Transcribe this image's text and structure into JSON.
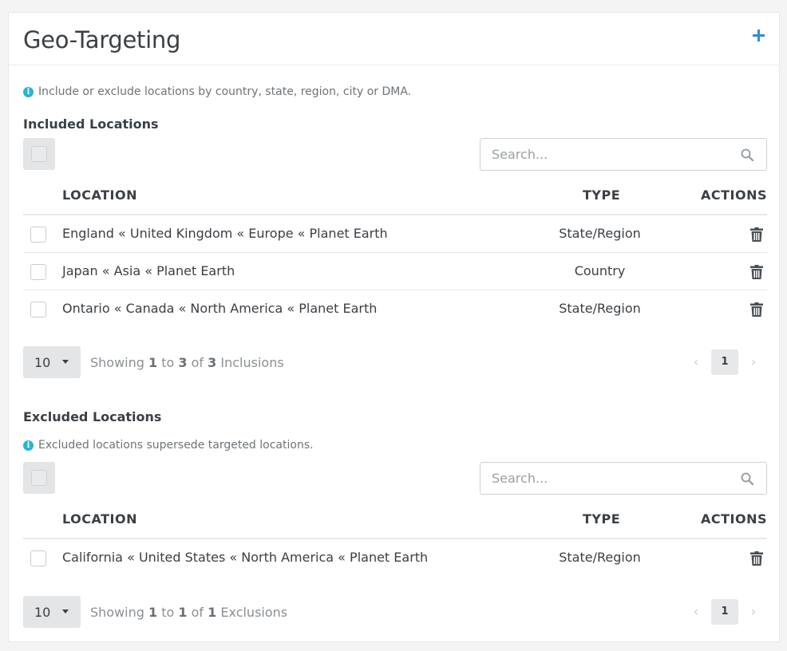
{
  "header": {
    "title": "Geo-Targeting",
    "add_icon": "plus-icon"
  },
  "info_text": "Include or exclude locations by country, state, region, city or DMA.",
  "included": {
    "title": "Included Locations",
    "search_placeholder": "Search...",
    "columns": {
      "location": "LOCATION",
      "type": "TYPE",
      "actions": "ACTIONS"
    },
    "rows": [
      {
        "location": "England « United Kingdom « Europe « Planet Earth",
        "type": "State/Region"
      },
      {
        "location": "Japan « Asia « Planet Earth",
        "type": "Country"
      },
      {
        "location": "Ontario « Canada « North America « Planet Earth",
        "type": "State/Region"
      }
    ],
    "pager": {
      "per_page": "10",
      "showing_prefix": "Showing",
      "from": "1",
      "to_word": "to",
      "to": "3",
      "of_word": "of",
      "total": "3",
      "noun": "Inclusions",
      "page": "1",
      "prev": "‹",
      "next": "›"
    }
  },
  "excluded": {
    "title": "Excluded Locations",
    "info_text": "Excluded locations supersede targeted locations.",
    "search_placeholder": "Search...",
    "columns": {
      "location": "LOCATION",
      "type": "TYPE",
      "actions": "ACTIONS"
    },
    "rows": [
      {
        "location": "California « United States « North America « Planet Earth",
        "type": "State/Region"
      }
    ],
    "pager": {
      "per_page": "10",
      "showing_prefix": "Showing",
      "from": "1",
      "to_word": "to",
      "to": "1",
      "of_word": "of",
      "total": "1",
      "noun": "Exclusions",
      "page": "1",
      "prev": "‹",
      "next": "›"
    }
  },
  "colors": {
    "accent": "#2d8fd5",
    "info": "#28b4d8"
  }
}
